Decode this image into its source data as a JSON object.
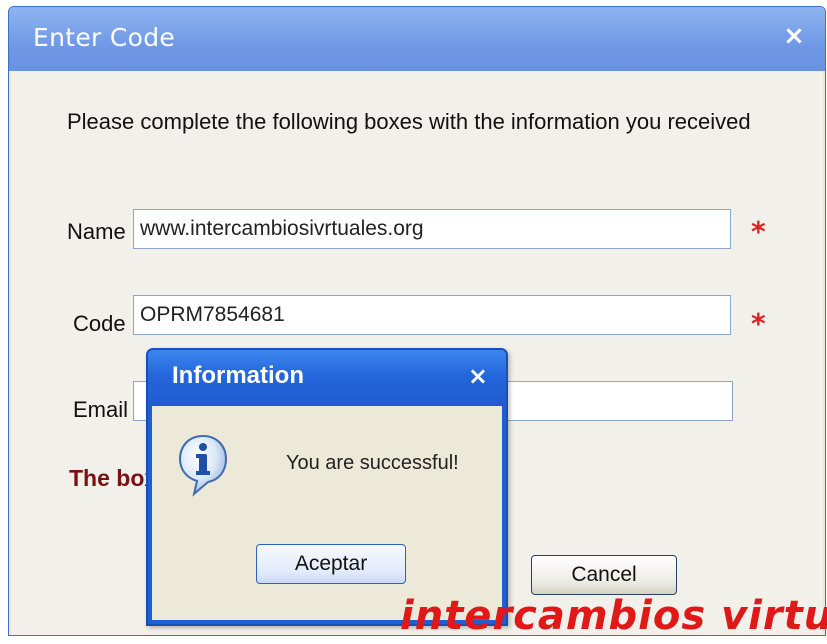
{
  "main_dialog": {
    "title": "Enter Code",
    "close_glyph": "×",
    "instructions": "Please complete the following boxes with the information you received",
    "fields": {
      "name": {
        "label": "Name",
        "value": "www.intercambiosivrtuales.org",
        "required_mark": "*"
      },
      "code": {
        "label": "Code",
        "value": "OPRM7854681",
        "required_mark": "*"
      },
      "email": {
        "label": "Email",
        "value": ""
      }
    },
    "error_text": "The boxes with * must be filled!",
    "cancel_label": "Cancel"
  },
  "info_dialog": {
    "title": "Information",
    "close_glyph": "×",
    "message": "You are successful!",
    "ok_label": "Aceptar",
    "icon": "info-icon"
  },
  "watermark": "intercambios virtuales",
  "colors": {
    "main_titlebar": "#6f99e6",
    "info_titlebar": "#2466dc",
    "required_star": "#e02020",
    "error_text": "#7a1010",
    "watermark": "#e01818"
  }
}
